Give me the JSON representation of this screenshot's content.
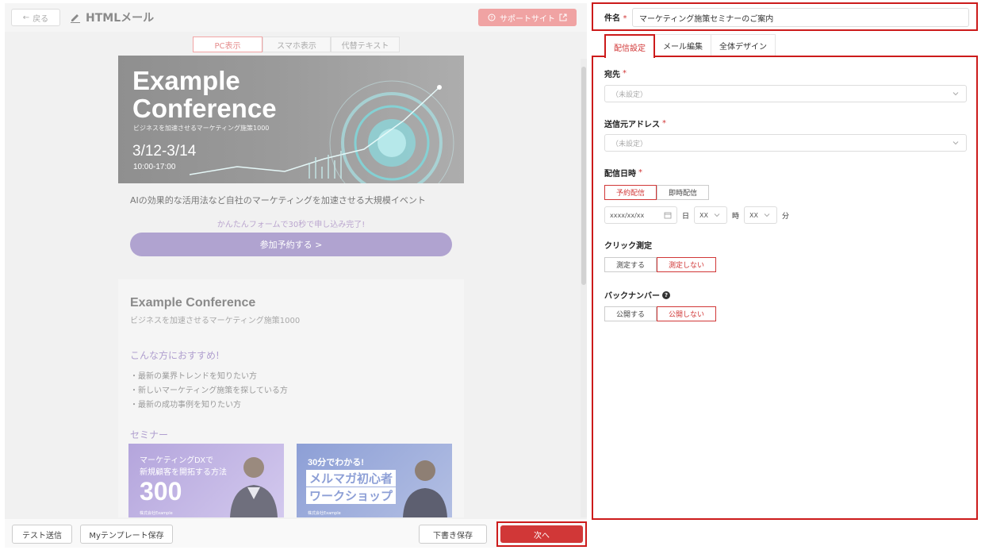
{
  "header": {
    "back_label": "戻る",
    "title": "HTMLメール",
    "support_label": "サポートサイト"
  },
  "view_tabs": [
    {
      "label": "PC表示",
      "active": true
    },
    {
      "label": "スマホ表示",
      "active": false
    },
    {
      "label": "代替テキスト",
      "active": false
    }
  ],
  "preview": {
    "hero_title_1": "Example",
    "hero_title_2": "Conference",
    "hero_subtitle": "ビジネスを加速させるマーケティング施策1000",
    "hero_date": "3/12-3/14",
    "hero_time": "10:00-17:00",
    "tagline": "AIの効果的な活用法など自社のマーケティングを加速させる大規模イベント",
    "form_note": "かんたんフォームで30秒で申し込み完了!",
    "cta_label": "参加予約する >",
    "card_title": "Example Conference",
    "card_subtitle": "ビジネスを加速させるマーケティング施策1000",
    "recommend_title": "こんな方におすすめ!",
    "recommend_items": [
      "・最新の業界トレンドを知りたい方",
      "・新しいマーケティング施策を探している方",
      "・最新の成功事例を知りたい方"
    ],
    "seminar_title": "セミナー",
    "seminar1": {
      "line1": "マーケティングDXで",
      "line2": "新規顧客を開拓する方法",
      "number": "300",
      "company": "株式会社Example"
    },
    "seminar2": {
      "line1": "30分でわかる!",
      "line2": "メルマガ初心者",
      "line3": "ワークショップ",
      "company": "株式会社Example"
    }
  },
  "footer": {
    "test_send": "テスト送信",
    "save_template": "Myテンプレート保存",
    "save_draft": "下書き保存",
    "next": "次へ"
  },
  "form": {
    "subject_label": "件名",
    "subject_value": "マーケティング施策セミナーのご案内",
    "tabs": [
      {
        "label": "配信設定",
        "active": true
      },
      {
        "label": "メール編集",
        "active": false
      },
      {
        "label": "全体デザイン",
        "active": false
      }
    ],
    "recipient_label": "宛先",
    "recipient_value": "（未設定）",
    "sender_label": "送信元アドレス",
    "sender_value": "（未設定）",
    "schedule_label": "配信日時",
    "schedule_options": [
      {
        "label": "予約配信",
        "active": true
      },
      {
        "label": "即時配信",
        "active": false
      }
    ],
    "date_value": "xxxx/xx/xx",
    "day_unit": "日",
    "hour_value": "XX",
    "hour_unit": "時",
    "minute_value": "XX",
    "minute_unit": "分",
    "click_label": "クリック測定",
    "click_options": [
      {
        "label": "測定する",
        "active": false
      },
      {
        "label": "測定しない",
        "active": true
      }
    ],
    "backnumber_label": "バックナンバー",
    "backnumber_options": [
      {
        "label": "公開する",
        "active": false
      },
      {
        "label": "公開しない",
        "active": true
      }
    ],
    "required_mark": "*"
  },
  "colors": {
    "accent_red": "#d13737",
    "highlight_border": "#cc1b1b",
    "cta_purple": "#b0a3d0"
  }
}
